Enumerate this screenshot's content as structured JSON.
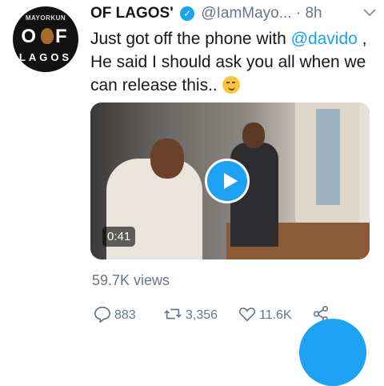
{
  "avatar": {
    "top_text": "MAYORKUN",
    "mid_left": "O",
    "mid_right": "F",
    "bottom_text": "LAGOS"
  },
  "tweet": {
    "name": "OF LAGOS'",
    "handle": "@IamMayo...",
    "separator": "·",
    "time": "8h",
    "text_part1": "Just got off the phone with ",
    "mention": "@davido",
    "text_part2": " , He said I should ask you all when we can release this.. "
  },
  "video": {
    "duration": "0:41"
  },
  "views": "59.7K views",
  "actions": {
    "replies": "883",
    "retweets": "3,356",
    "likes": "11.6K"
  },
  "colors": {
    "accent": "#1da1f2",
    "muted": "#657786"
  }
}
